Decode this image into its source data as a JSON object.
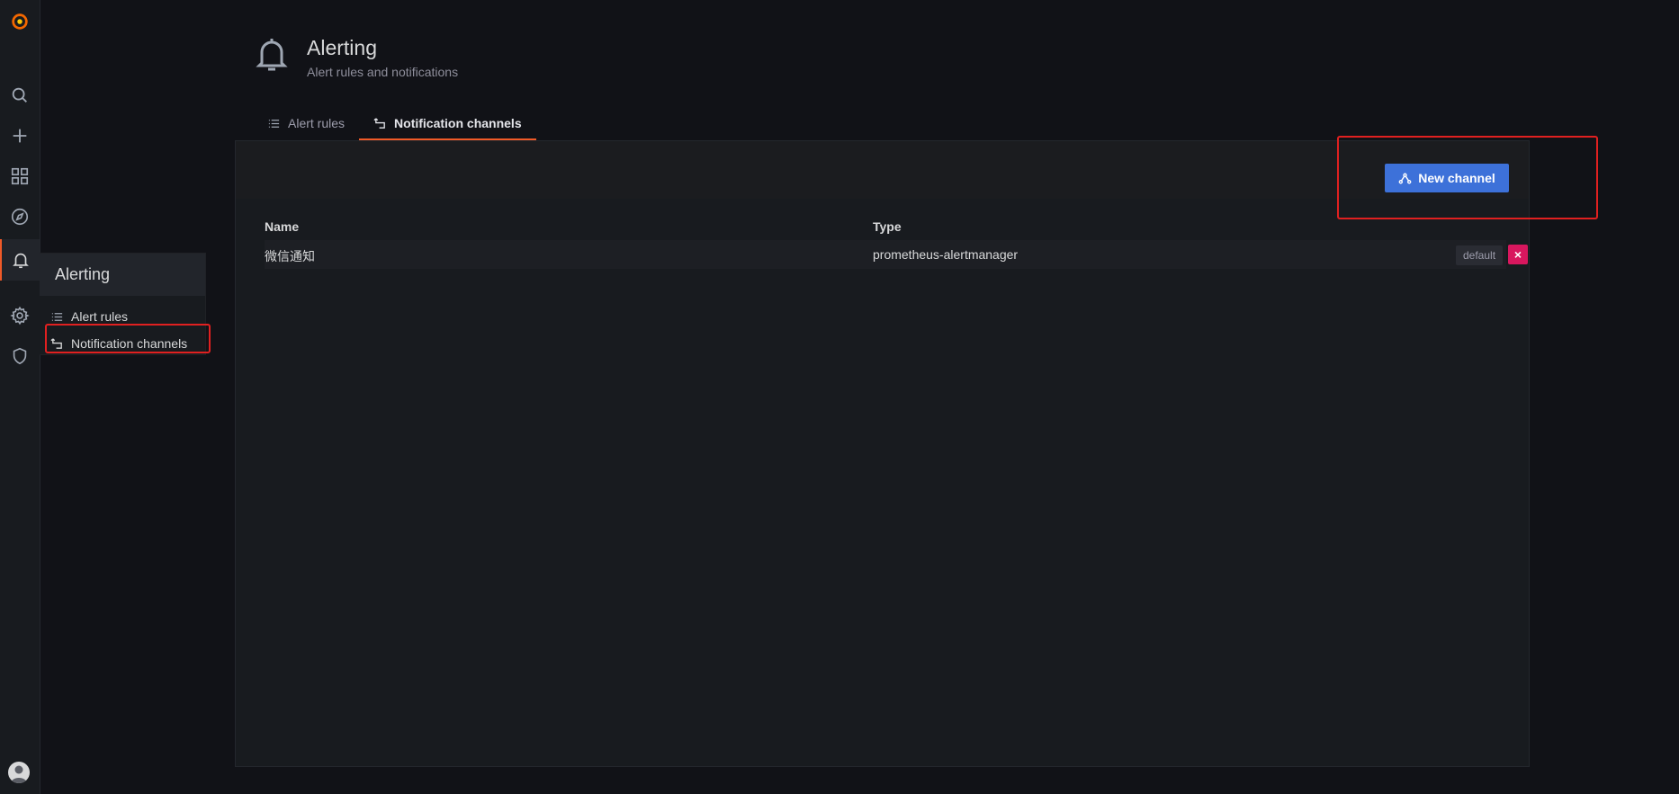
{
  "sidebar": {
    "items": [
      {
        "icon": "grafana-logo"
      },
      {
        "icon": "search-icon"
      },
      {
        "icon": "plus-icon"
      },
      {
        "icon": "dashboards-icon"
      },
      {
        "icon": "explore-icon"
      },
      {
        "icon": "bell-icon"
      },
      {
        "icon": "gear-icon"
      },
      {
        "icon": "shield-icon"
      }
    ],
    "submenu": {
      "title": "Alerting",
      "items": [
        {
          "label": "Alert rules",
          "icon": "list-icon"
        },
        {
          "label": "Notification channels",
          "icon": "channel-icon"
        }
      ]
    }
  },
  "header": {
    "title": "Alerting",
    "subtitle": "Alert rules and notifications"
  },
  "tabs": [
    {
      "label": "Alert rules",
      "active": false
    },
    {
      "label": "Notification channels",
      "active": true
    }
  ],
  "toolbar": {
    "new_channel_label": "New channel"
  },
  "table": {
    "columns": [
      "Name",
      "Type"
    ],
    "rows": [
      {
        "name": "微信通知",
        "type": "prometheus-alertmanager",
        "badge": "default",
        "delete": "×"
      }
    ]
  },
  "colors": {
    "accent": "#f05a28",
    "primary": "#3d71d9",
    "danger": "#d8175e",
    "background": "#111217",
    "panel": "#181b1f"
  }
}
